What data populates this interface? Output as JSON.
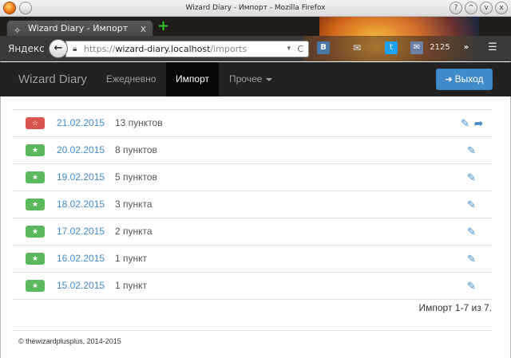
{
  "window": {
    "title": "Wizard Diary - Импорт - Mozilla Firefox",
    "controls": [
      "?",
      "^",
      "v",
      "x"
    ]
  },
  "browser": {
    "tab_title": "Wizard Diary - Импорт",
    "tab_close": "x",
    "new_tab": "+",
    "yandex": "Яндекс",
    "back_glyph": "←",
    "url_scheme": "https://",
    "url_host": "wizard-diary.localhost",
    "url_path": "/imports",
    "url_dropdown": "▾",
    "url_reload": "C",
    "toolbar": {
      "vk_label": "В",
      "mail_glyph": "✉",
      "twitter_glyph": "t",
      "mailbox_glyph": "✉",
      "counter": "2125",
      "more_glyph": "»",
      "menu_glyph": "☰"
    }
  },
  "site_nav": {
    "brand": "Wizard Diary",
    "items": [
      {
        "label": "Ежедневно",
        "active": false
      },
      {
        "label": "Импорт",
        "active": true
      },
      {
        "label": "Прочее",
        "active": false,
        "dropdown": true
      }
    ],
    "logout_label": "Выход",
    "logout_icon": "sign-out-icon"
  },
  "imports": {
    "rows": [
      {
        "starred": true,
        "star_color": "#d9534f",
        "star_glyph": "☆",
        "date": "21.02.2015",
        "count": "13 пунктов",
        "edit_glyph": "✎",
        "share": true,
        "share_glyph": "➦"
      },
      {
        "starred": false,
        "star_color": "#5cb85c",
        "star_glyph": "★",
        "date": "20.02.2015",
        "count": "8 пунктов",
        "edit_glyph": "✎",
        "share": false
      },
      {
        "starred": false,
        "star_color": "#5cb85c",
        "star_glyph": "★",
        "date": "19.02.2015",
        "count": "5 пунктов",
        "edit_glyph": "✎",
        "share": false
      },
      {
        "starred": false,
        "star_color": "#5cb85c",
        "star_glyph": "★",
        "date": "18.02.2015",
        "count": "3 пункта",
        "edit_glyph": "✎",
        "share": false
      },
      {
        "starred": false,
        "star_color": "#5cb85c",
        "star_glyph": "★",
        "date": "17.02.2015",
        "count": "2 пункта",
        "edit_glyph": "✎",
        "share": false
      },
      {
        "starred": false,
        "star_color": "#5cb85c",
        "star_glyph": "★",
        "date": "16.02.2015",
        "count": "1 пункт",
        "edit_glyph": "✎",
        "share": false
      },
      {
        "starred": false,
        "star_color": "#5cb85c",
        "star_glyph": "★",
        "date": "15.02.2015",
        "count": "1 пункт",
        "edit_glyph": "✎",
        "share": false
      }
    ],
    "pager_summary": "Импорт 1-7 из 7."
  },
  "footer": {
    "copyright": "© thewizardplusplus, 2014-2015"
  },
  "colors": {
    "accent": "#428bca",
    "navbar_bg": "#222222",
    "star_green": "#5cb85c",
    "star_red": "#d9534f"
  }
}
